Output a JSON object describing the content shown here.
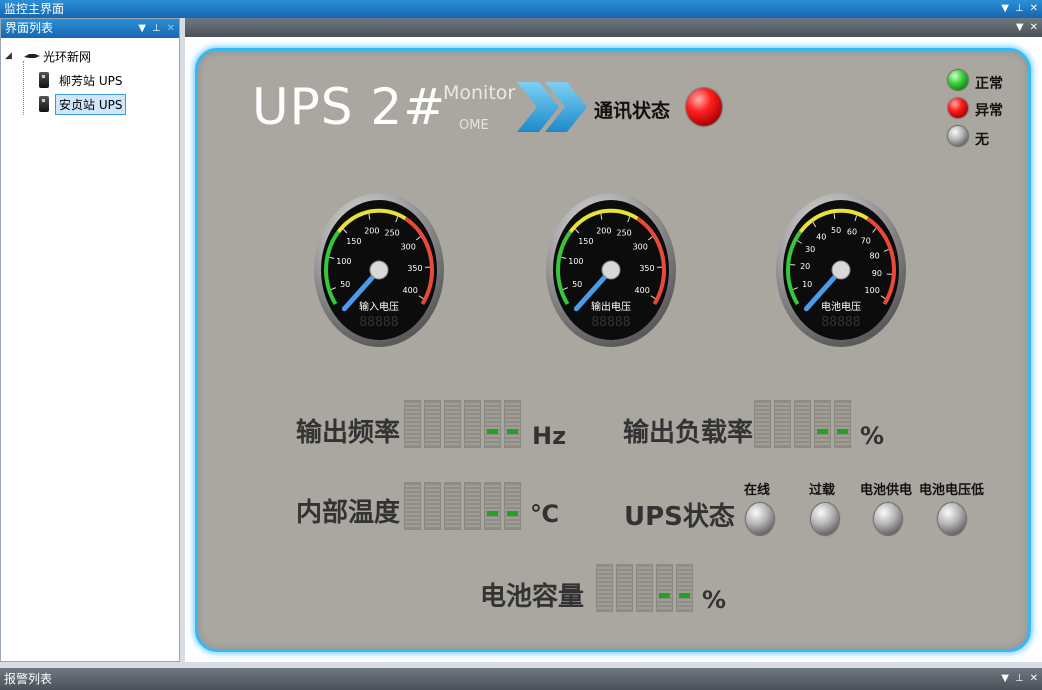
{
  "window": {
    "title": "监控主界面"
  },
  "sidebar": {
    "title": "界面列表",
    "tree": {
      "root_label": "光环新网",
      "children": [
        {
          "label": "柳芳站 UPS"
        },
        {
          "label": "安贞站 UPS"
        }
      ]
    }
  },
  "monitor": {
    "ups_title": "UPS 2#",
    "monitor_text": "Monitor",
    "ome_text": "OME",
    "comm_label": "通讯状态",
    "legend": [
      {
        "label": "正常",
        "color": "green"
      },
      {
        "label": "异常",
        "color": "red"
      },
      {
        "label": "无",
        "color": "gray"
      }
    ],
    "gauges": [
      {
        "label": "输入电压",
        "ticks": [
          "50",
          "100",
          "150",
          "200",
          "250",
          "300",
          "350",
          "400"
        ],
        "display": "88888"
      },
      {
        "label": "输出电压",
        "ticks": [
          "50",
          "100",
          "150",
          "200",
          "250",
          "300",
          "350",
          "400"
        ],
        "display": "88888"
      },
      {
        "label": "电池电压",
        "ticks": [
          "10",
          "20",
          "30",
          "40",
          "50",
          "60",
          "70",
          "80",
          "90",
          "100"
        ],
        "display": "88888"
      }
    ],
    "readouts": {
      "out_freq": {
        "label": "输出频率",
        "unit": "Hz",
        "value": "--"
      },
      "out_load": {
        "label": "输出负载率",
        "unit": "%",
        "value": "--"
      },
      "inner_temp": {
        "label": "内部温度",
        "unit": "℃",
        "value": "--"
      },
      "battery_cap": {
        "label": "电池容量",
        "unit": "%",
        "value": "--"
      }
    },
    "ups_state": {
      "label": "UPS状态",
      "items": [
        "在线",
        "过载",
        "电池供电",
        "电池电压低"
      ]
    }
  },
  "bottom_panel": {
    "title": "报警列表"
  },
  "colors": {
    "accent": "#37b8f2",
    "panel_bg": "#a9a79f",
    "digit_green": "#1ea51e"
  }
}
